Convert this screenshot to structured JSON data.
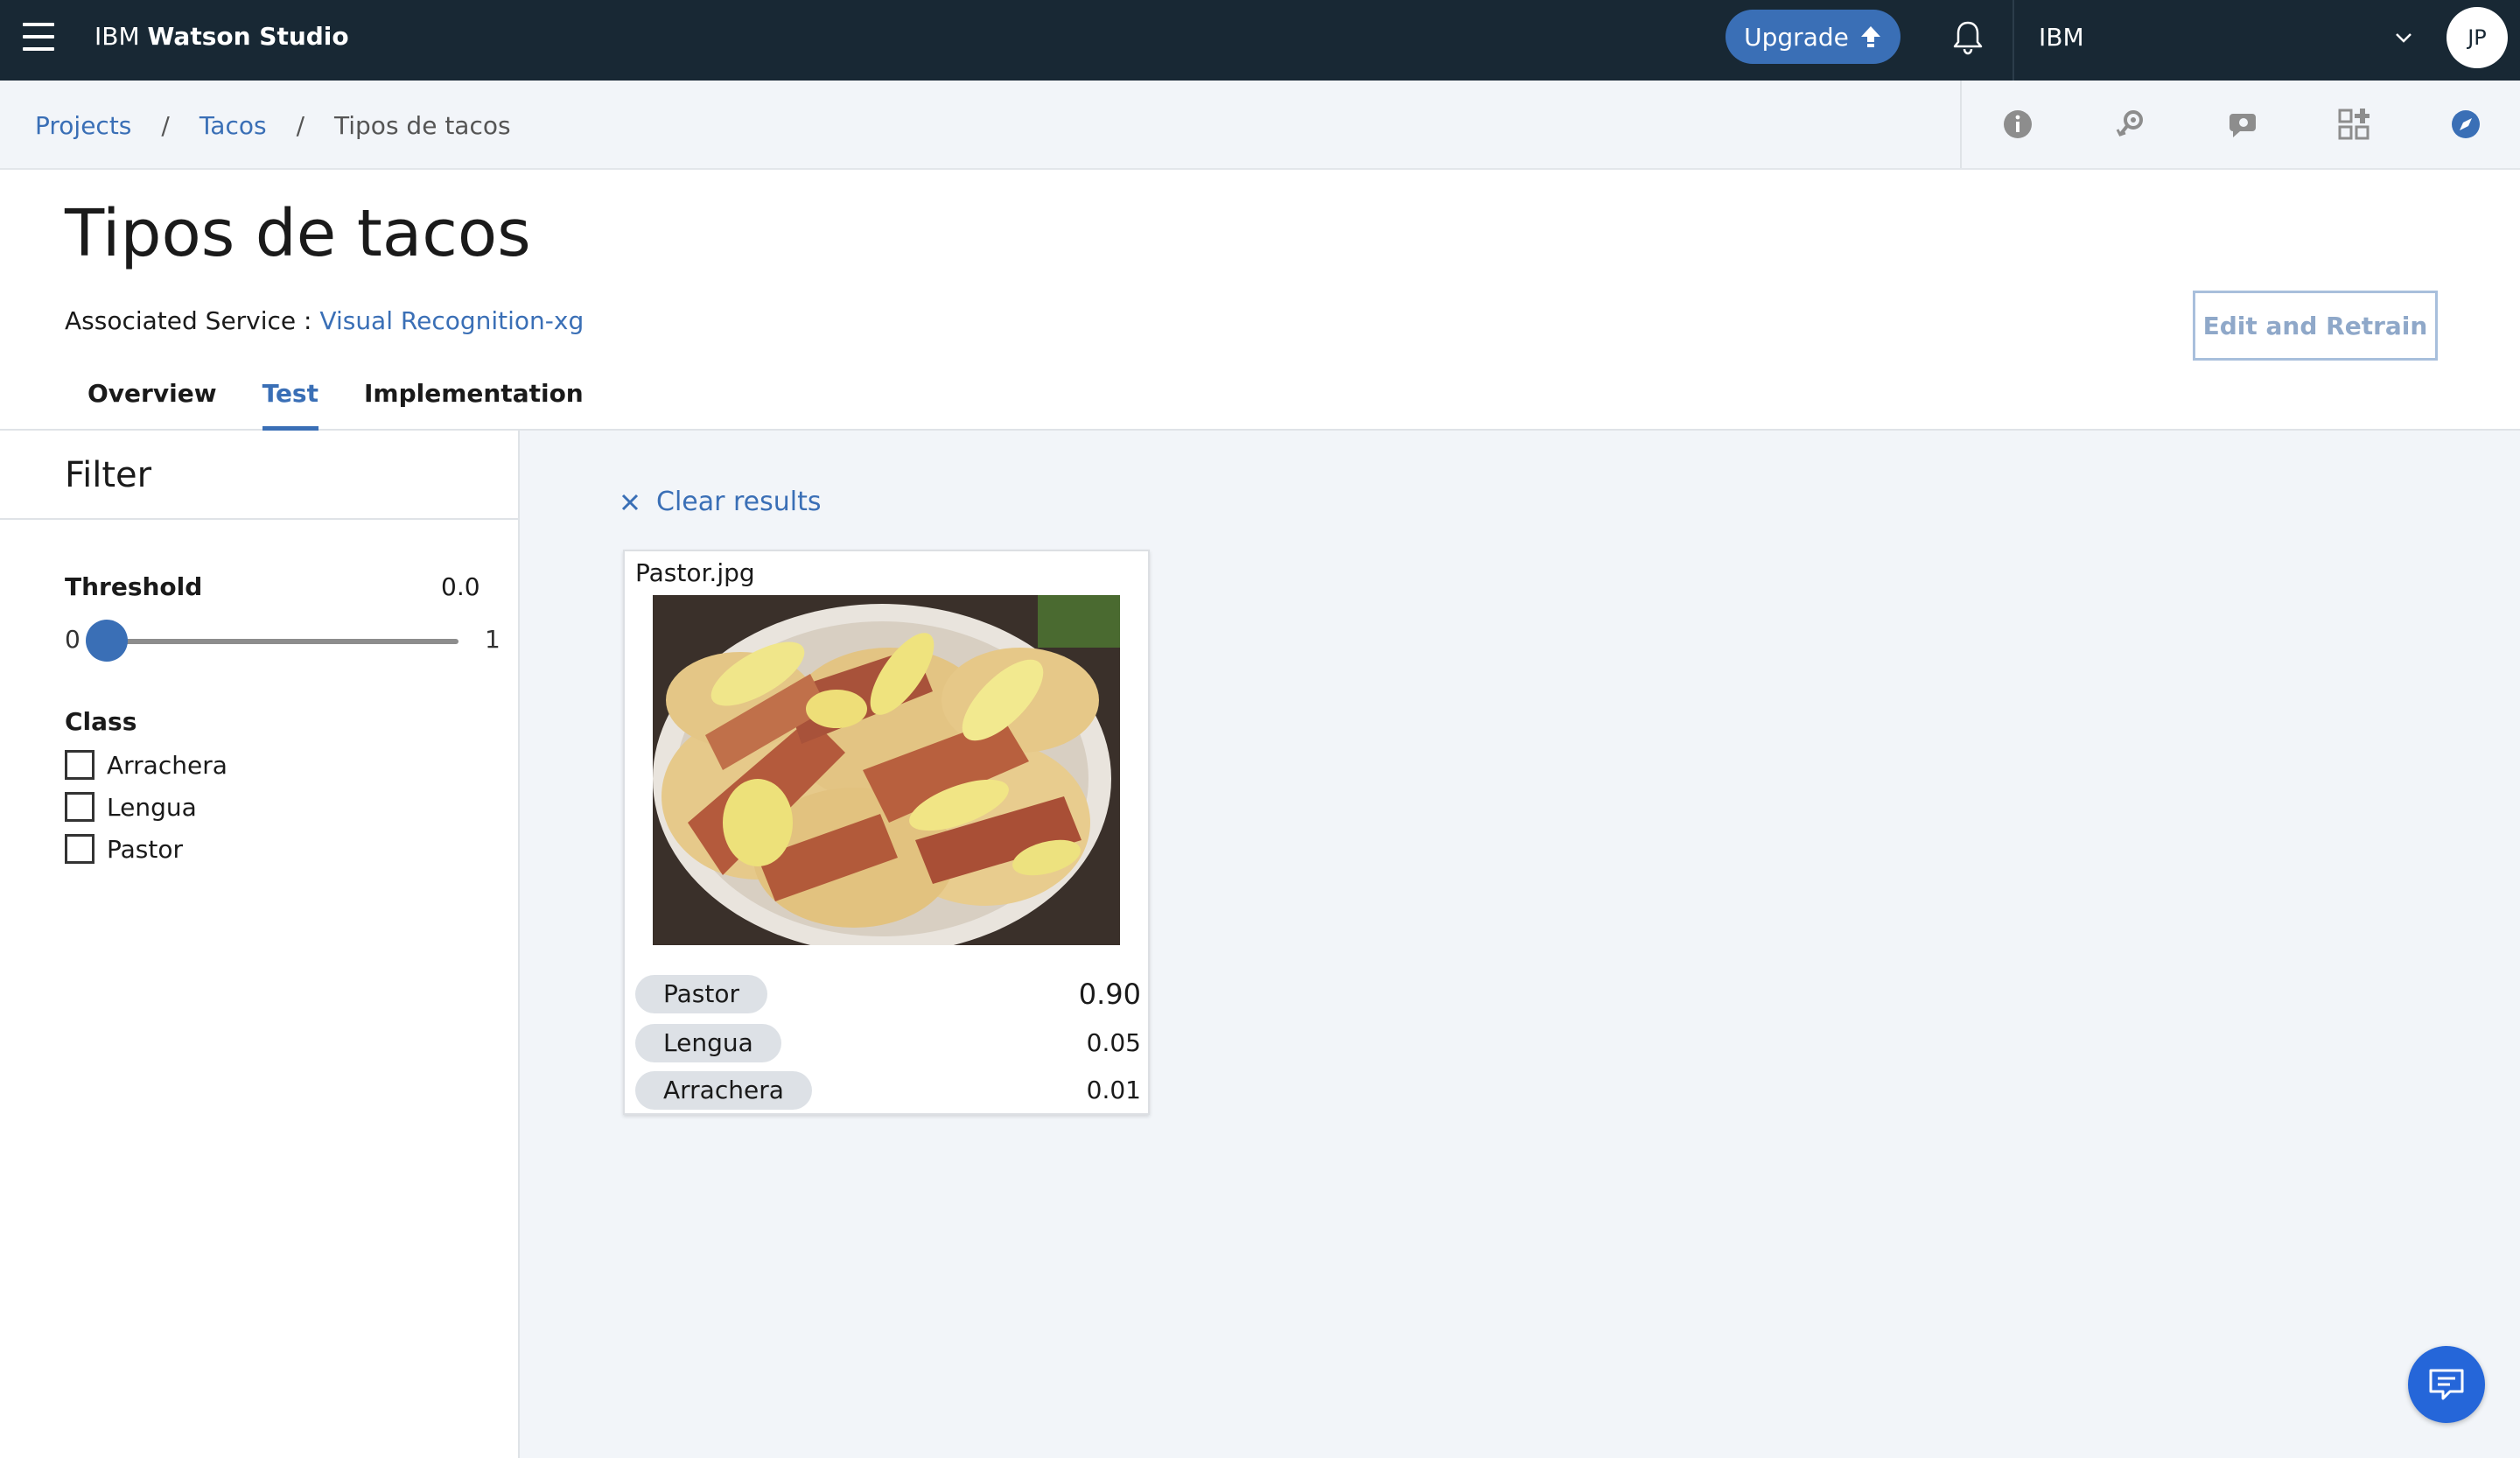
{
  "topbar": {
    "brand_prefix": "IBM",
    "brand_name": "Watson Studio",
    "upgrade_label": "Upgrade",
    "account_name": "IBM",
    "avatar_initials": "JP"
  },
  "breadcrumb": {
    "items": [
      {
        "label": "Projects"
      },
      {
        "label": "Tacos"
      },
      {
        "label": "Tipos de tacos"
      }
    ],
    "separator": "/"
  },
  "header": {
    "title": "Tipos de tacos",
    "assoc_label": "Associated Service :",
    "assoc_link": "Visual Recognition-xg",
    "retrain_label": "Edit and Retrain",
    "tabs": [
      {
        "label": "Overview"
      },
      {
        "label": "Test"
      },
      {
        "label": "Implementation"
      }
    ],
    "active_tab": "Test"
  },
  "filter": {
    "title": "Filter",
    "threshold_label": "Threshold",
    "threshold_value": "0.0",
    "slider_min": "0",
    "slider_max": "1",
    "class_label": "Class",
    "classes": [
      {
        "label": "Arrachera",
        "checked": false
      },
      {
        "label": "Lengua",
        "checked": false
      },
      {
        "label": "Pastor",
        "checked": false
      }
    ]
  },
  "results": {
    "clear_label": "Clear results",
    "card": {
      "file_name": "Pastor.jpg",
      "scores": [
        {
          "class": "Pastor",
          "score": "0.90"
        },
        {
          "class": "Lengua",
          "score": "0.05"
        },
        {
          "class": "Arrachera",
          "score": "0.01"
        }
      ]
    }
  },
  "colors": {
    "topbar_bg": "#182834",
    "accent": "#3a6fb6",
    "chat_button": "#2566d9"
  }
}
